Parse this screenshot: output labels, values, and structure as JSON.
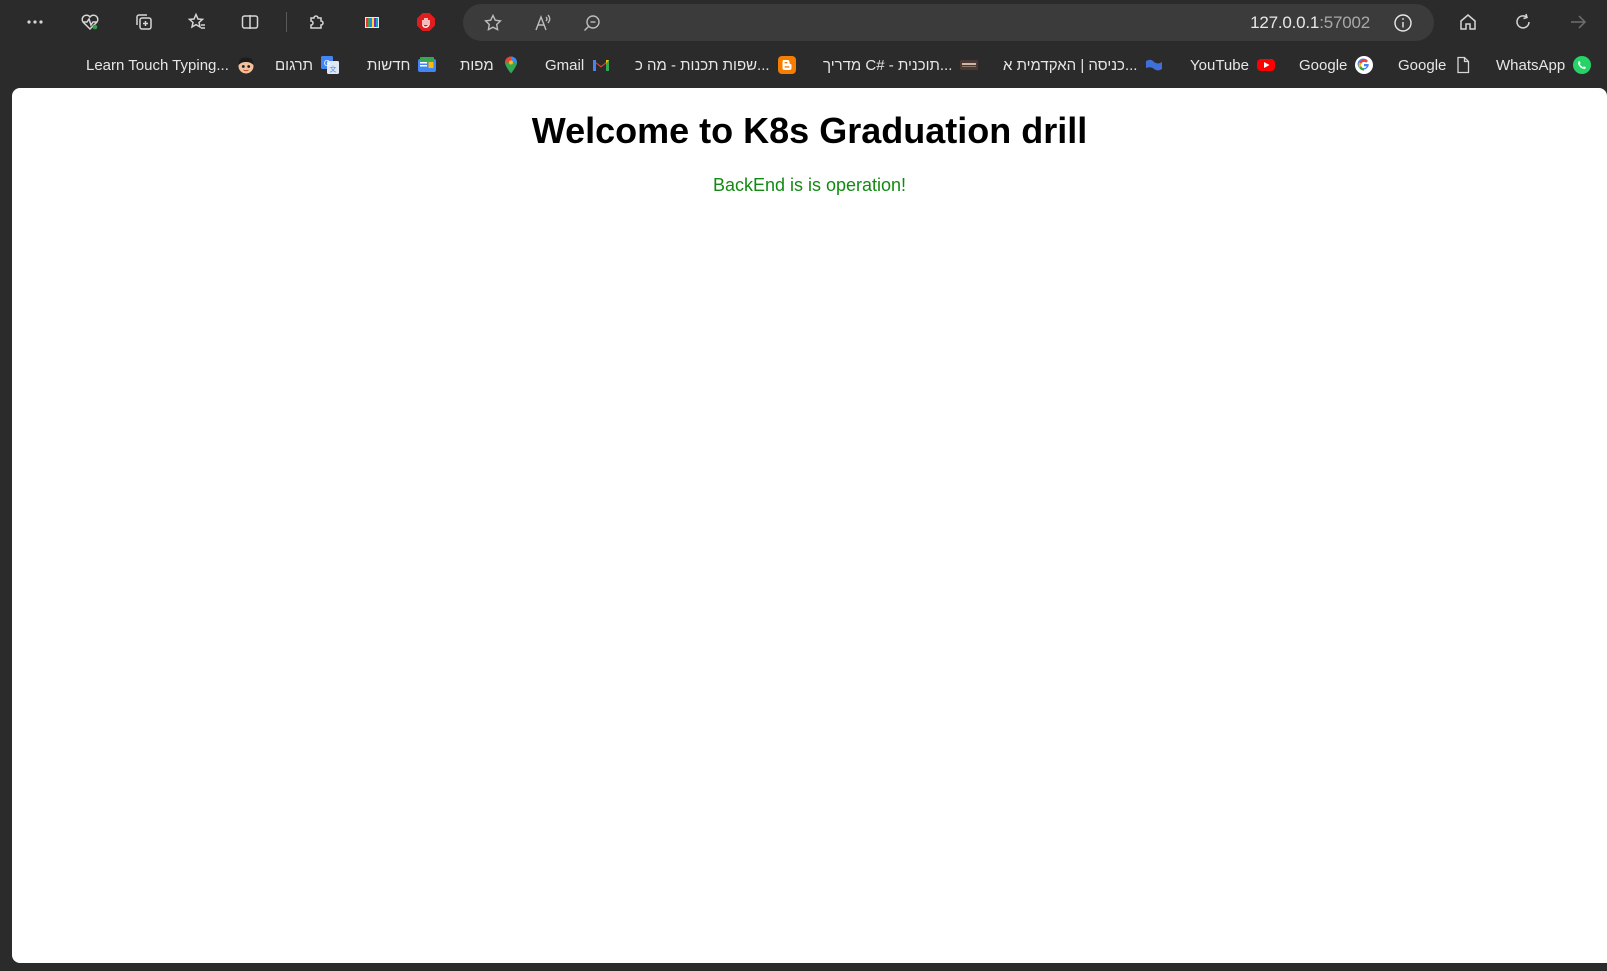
{
  "browser": {
    "url_host": "127.0.0.1",
    "url_port": ":57002"
  },
  "bookmarks": [
    {
      "label": "WhatsApp",
      "icon": "whatsapp-icon",
      "color": "#25d366"
    },
    {
      "label": "Google",
      "icon": "page-icon",
      "color": "#d6d6d6"
    },
    {
      "label": "Google",
      "icon": "google-icon",
      "color": "#4285f4"
    },
    {
      "label": "YouTube",
      "icon": "youtube-icon",
      "color": "#ff0000"
    },
    {
      "label": "כניסה | האקדמית א...",
      "icon": "flag-icon",
      "color": "#3f6fd8"
    },
    {
      "label": "מדריך C# - תוכנית...",
      "icon": "book-icon",
      "color": "#6b4a3a"
    },
    {
      "label": "שפות תכנות - מה כ...",
      "icon": "blogger-icon",
      "color": "#f57d00"
    },
    {
      "label": "Gmail",
      "icon": "gmail-icon",
      "color": "#ea4335"
    },
    {
      "label": "מפות",
      "icon": "maps-icon",
      "color": "#34a853"
    },
    {
      "label": "חדשות",
      "icon": "news-icon",
      "color": "#4285f4"
    },
    {
      "label": "תרגום",
      "icon": "translate-icon",
      "color": "#4285f4"
    },
    {
      "label": "Learn Touch Typing...",
      "icon": "typing-icon",
      "color": "#f2c29b"
    }
  ],
  "page": {
    "title": "Welcome to K8s Graduation drill",
    "status": "BackEnd is is operation!",
    "status_color": "#128a12"
  }
}
